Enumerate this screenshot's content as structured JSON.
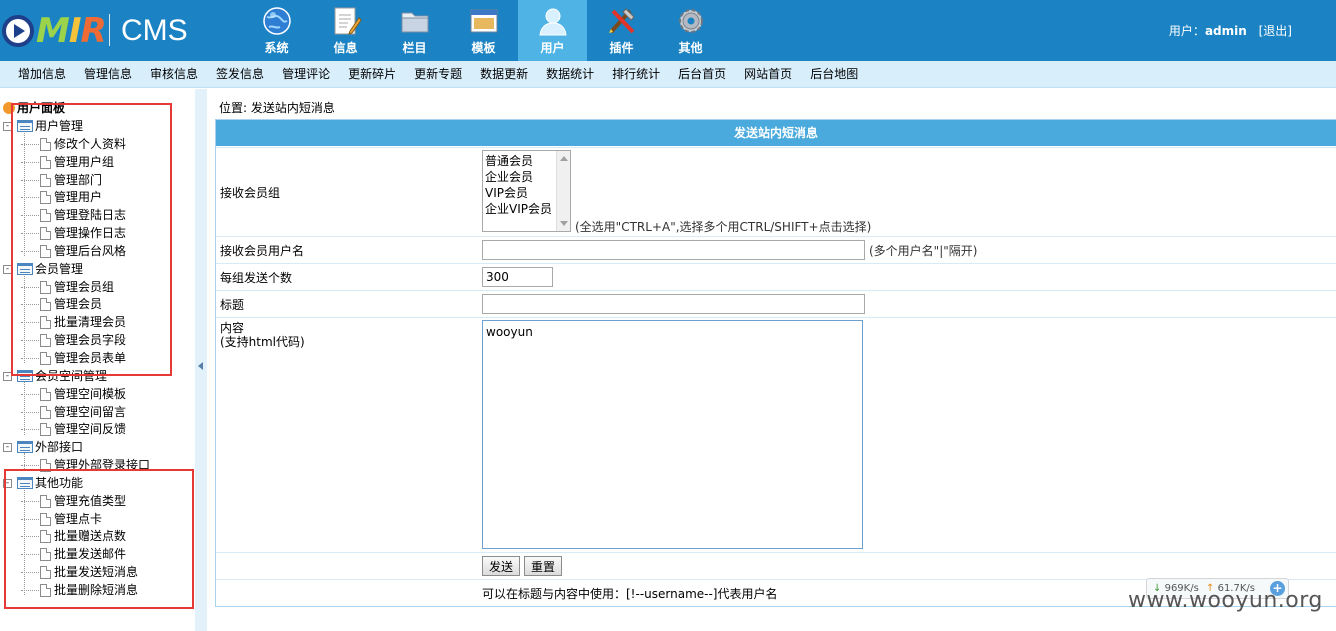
{
  "header": {
    "logo_text": "MIR",
    "logo_product": "CMS",
    "nav": [
      {
        "label": "系统",
        "icon": "globe-icon",
        "active": false
      },
      {
        "label": "信息",
        "icon": "document-pen-icon",
        "active": false
      },
      {
        "label": "栏目",
        "icon": "folder-icon",
        "active": false
      },
      {
        "label": "模板",
        "icon": "template-window-icon",
        "active": false
      },
      {
        "label": "用户",
        "icon": "user-icon",
        "active": true
      },
      {
        "label": "插件",
        "icon": "tools-icon",
        "active": false
      },
      {
        "label": "其他",
        "icon": "gear-icon",
        "active": false
      }
    ],
    "user_prefix": "用户：",
    "username": "admin",
    "logout_label": "[退出]",
    "bg_color": "#1b83c4",
    "active_color": "#4fb3e6"
  },
  "submenu": [
    "增加信息",
    "管理信息",
    "审核信息",
    "签发信息",
    "管理评论",
    "更新碎片",
    "更新专题",
    "数据更新",
    "数据统计",
    "排行统计",
    "后台首页",
    "网站首页",
    "后台地图"
  ],
  "sidebar": {
    "title": "用户面板",
    "groups": [
      {
        "label": "用户管理",
        "items": [
          "修改个人资料",
          "管理用户组",
          "管理部门",
          "管理用户",
          "管理登陆日志",
          "管理操作日志",
          "管理后台风格"
        ]
      },
      {
        "label": "会员管理",
        "items": [
          "管理会员组",
          "管理会员",
          "批量清理会员",
          "管理会员字段",
          "管理会员表单"
        ]
      },
      {
        "label": "会员空间管理",
        "items": [
          "管理空间模板",
          "管理空间留言",
          "管理空间反馈"
        ]
      },
      {
        "label": "外部接口",
        "items": [
          "管理外部登录接口"
        ]
      },
      {
        "label": "其他功能",
        "items": [
          "管理充值类型",
          "管理点卡",
          "批量赠送点数",
          "批量发送邮件",
          "批量发送短消息",
          "批量删除短消息"
        ]
      }
    ]
  },
  "main": {
    "breadcrumb": "位置: 发送站内短消息",
    "form_title": "发送站内短消息",
    "fields": {
      "groups_label": "接收会员组",
      "groups_options": [
        "普通会员",
        "企业会员",
        "VIP会员",
        "企业VIP会员"
      ],
      "groups_hint": "(全选用\"CTRL+A\",选择多个用CTRL/SHIFT+点击选择)",
      "username_label": "接收会员用户名",
      "username_value": "",
      "username_hint": "(多个用户名\"|\"隔开)",
      "batch_label": "每组发送个数",
      "batch_value": "300",
      "title_label": "标题",
      "title_value": "",
      "content_label": "内容",
      "content_sublabel": "(支持html代码)",
      "content_value": "wooyun"
    },
    "send_label": "发送",
    "reset_label": "重置",
    "footer_note": "可以在标题与内容中使用：[!--username--]代表用户名"
  },
  "overlay": {
    "download_speed": "969K/s",
    "upload_speed": "61.7K/s",
    "watermark": "www.wooyun.org"
  }
}
